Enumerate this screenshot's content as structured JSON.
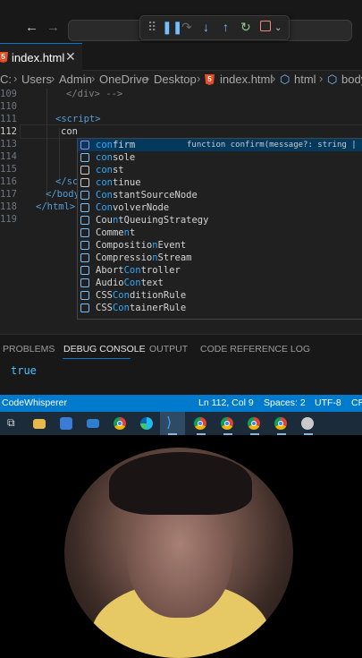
{
  "titlebar": {
    "back_icon": "arrow-left-icon",
    "forward_icon": "arrow-right-icon"
  },
  "debug_toolbar": {
    "icons": [
      "drag-handle-icon",
      "pause-icon",
      "step-over-icon",
      "step-into-icon",
      "step-out-icon",
      "restart-icon",
      "stop-icon",
      "chevron-down-icon"
    ]
  },
  "tab": {
    "label": "index.html",
    "close": "✕",
    "icon_text": "5"
  },
  "breadcrumb": {
    "items": [
      "C:",
      "Users",
      "Admin",
      "OneDrive",
      "Desktop",
      "index.html",
      "html",
      "body"
    ]
  },
  "editor": {
    "lines": [
      {
        "num": "109",
        "text": "</div> -->"
      },
      {
        "num": "110",
        "text": ""
      },
      {
        "num": "111",
        "text": "<script>"
      },
      {
        "num": "112",
        "text": "con"
      },
      {
        "num": "113",
        "text": ""
      },
      {
        "num": "114",
        "text": ""
      },
      {
        "num": "115",
        "text": ""
      },
      {
        "num": "116",
        "text": "</sc"
      },
      {
        "num": "117",
        "text": "</body"
      },
      {
        "num": "118",
        "text": "</html>"
      },
      {
        "num": "119",
        "text": ""
      }
    ]
  },
  "suggest": {
    "items": [
      {
        "match": "con",
        "rest": "firm",
        "detail": "function confirm(message?: string | unde",
        "icon": "method-icon"
      },
      {
        "match": "con",
        "rest": "sole",
        "icon": "variable-icon"
      },
      {
        "match": "con",
        "rest": "st",
        "icon": "keyword-icon"
      },
      {
        "match": "con",
        "rest": "tinue",
        "icon": "keyword-icon"
      },
      {
        "match": "Con",
        "rest": "stantSourceNode",
        "icon": "variable-icon"
      },
      {
        "match": "Con",
        "rest": "volverNode",
        "icon": "variable-icon"
      },
      {
        "prefix": "Cou",
        "match": "n",
        "rest": "tQueuingStrategy",
        "icon": "variable-icon"
      },
      {
        "prefix": "Comme",
        "match": "n",
        "rest": "t",
        "icon": "variable-icon"
      },
      {
        "prefix": "Compositio",
        "match": "n",
        "rest": "Event",
        "icon": "variable-icon"
      },
      {
        "prefix": "Compressio",
        "match": "n",
        "rest": "Stream",
        "icon": "variable-icon"
      },
      {
        "prefix": "Abort",
        "match": "Con",
        "rest": "troller",
        "icon": "variable-icon"
      },
      {
        "prefix": "Audio",
        "match": "Con",
        "rest": "text",
        "icon": "variable-icon"
      },
      {
        "prefix": "CSS",
        "match": "Con",
        "rest": "ditionRule",
        "icon": "variable-icon"
      },
      {
        "prefix": "CSS",
        "match": "Con",
        "rest": "tainerRule",
        "icon": "variable-icon"
      }
    ]
  },
  "panel": {
    "tabs": [
      "PROBLEMS",
      "DEBUG CONSOLE",
      "OUTPUT",
      "CODE REFERENCE LOG"
    ],
    "active_tab": "DEBUG CONSOLE",
    "console_output": "true"
  },
  "statusbar": {
    "left": "CodeWhisperer",
    "position": "Ln 112, Col 9",
    "spaces": "Spaces: 2",
    "encoding": "UTF-8",
    "eol": "CR"
  },
  "taskbar": {
    "icons": [
      "task-view-icon",
      "file-explorer-icon",
      "store-icon",
      "mail-icon",
      "chrome-icon",
      "edge-icon",
      "vscode-icon",
      "chrome-profile-icon",
      "chrome-profile-icon",
      "chrome-icon",
      "chrome-icon",
      "chrome-profile-icon"
    ]
  },
  "colors": {
    "accent": "#007acc",
    "selection": "#04395e",
    "match": "#2aaaff",
    "tag": "#569cd6",
    "shirt": "#e6c964"
  }
}
